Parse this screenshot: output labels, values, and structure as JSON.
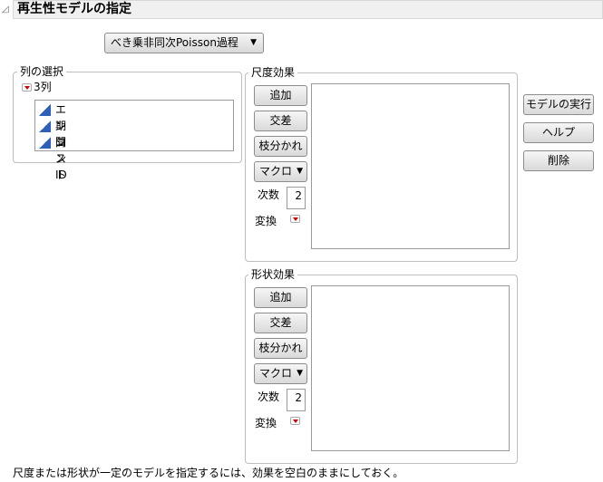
{
  "title": "再生性モデルの指定",
  "model_select": {
    "value": "べき乗非同次Poisson過程"
  },
  "column_selection": {
    "label": "列の選択",
    "group": "3列",
    "columns": [
      "エンジンID",
      "期間",
      "コスト"
    ]
  },
  "scale_effects": {
    "label": "尺度効果",
    "add": "追加",
    "cross": "交差",
    "nest": "枝分かれ",
    "macro": "マクロ",
    "degree_label": "次数",
    "degree": "2",
    "transform_label": "変換"
  },
  "shape_effects": {
    "label": "形状効果",
    "add": "追加",
    "cross": "交差",
    "nest": "枝分かれ",
    "macro": "マクロ",
    "degree_label": "次数",
    "degree": "2",
    "transform_label": "変換"
  },
  "actions": {
    "run": "モデルの実行",
    "help": "ヘルプ",
    "remove": "削除"
  },
  "footer": "尺度または形状が一定のモデルを指定するには、効果を空白のままにしておく。"
}
